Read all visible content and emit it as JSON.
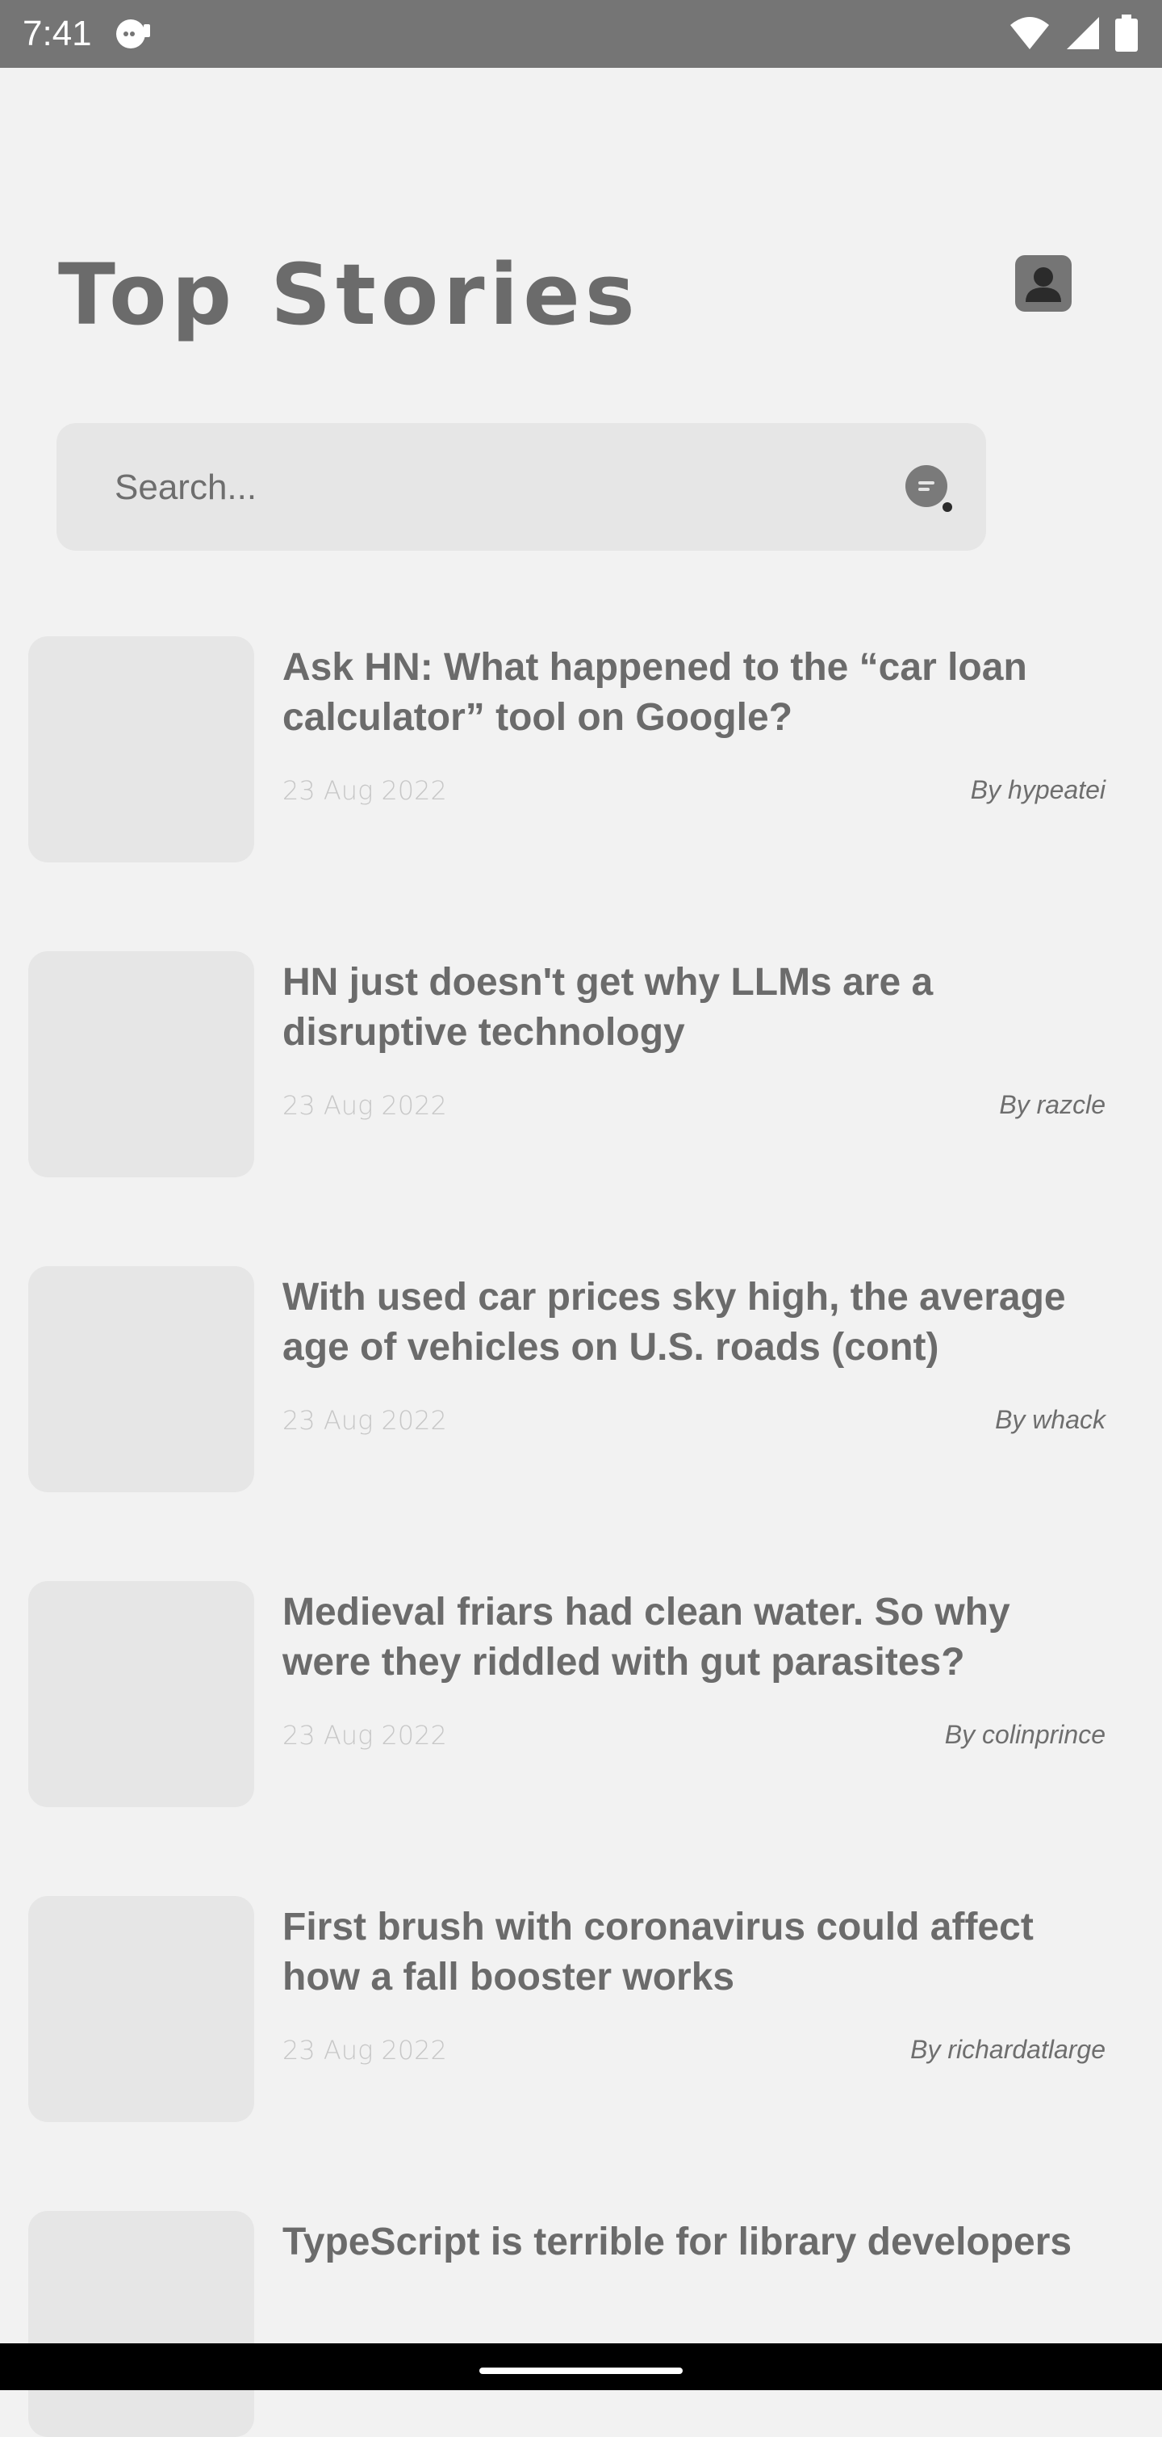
{
  "status_bar": {
    "time": "7:41",
    "icons": [
      "notification-icon",
      "wifi-icon",
      "signal-icon",
      "battery-icon"
    ]
  },
  "header": {
    "title": "Top Stories",
    "profile_icon": "account-icon"
  },
  "search": {
    "placeholder": "Search...",
    "filter_icon": "filter-icon"
  },
  "stories": [
    {
      "title": "Ask HN: What happened to the “car loan calculator” tool on Google?",
      "date": "23 Aug 2022",
      "author": "By hypeatei"
    },
    {
      "title": "HN just doesn't get why LLMs are a disruptive technology",
      "date": "23 Aug 2022",
      "author": "By razcle"
    },
    {
      "title": "With used car prices sky high, the average age of vehicles on U.S. roads (cont)",
      "date": "23 Aug 2022",
      "author": "By whack"
    },
    {
      "title": "Medieval friars had clean water. So why were they riddled with gut parasites?",
      "date": "23 Aug 2022",
      "author": "By colinprince"
    },
    {
      "title": "First brush with coronavirus could affect how a fall booster works",
      "date": "23 Aug 2022",
      "author": "By richardatlarge"
    },
    {
      "title": "TypeScript is terrible for library developers"
    }
  ],
  "colors": {
    "background": "#f2f2f2",
    "status_bar": "#757575",
    "placeholder_fill": "#e6e6e6",
    "text_primary": "#6b6b6b",
    "date_text": "#c7c7c7"
  }
}
